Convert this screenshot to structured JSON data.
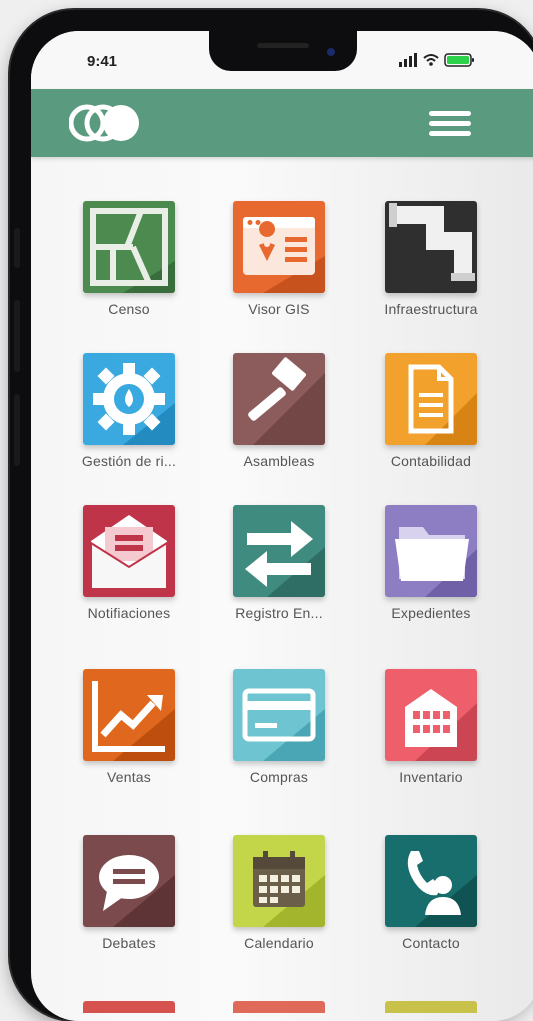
{
  "status_bar": {
    "time": "9:41"
  },
  "app_bar": {
    "logo": "app-logo",
    "menu_icon": "hamburger-menu-icon",
    "color": "#5a9a7f"
  },
  "tiles": [
    {
      "label": "Censo",
      "icon": "census-map-icon",
      "color": "#4d8a4f"
    },
    {
      "label": "Visor GIS",
      "icon": "gis-viewer-icon",
      "color": "#e8692f"
    },
    {
      "label": "Infraestructura",
      "icon": "pipes-icon",
      "color": "#2f2f2f"
    },
    {
      "label": "Gestión de ri...",
      "icon": "water-gear-icon",
      "color": "#3aa9df"
    },
    {
      "label": "Asambleas",
      "icon": "gavel-icon",
      "color": "#8c5b5b"
    },
    {
      "label": "Contabilidad",
      "icon": "document-icon",
      "color": "#f2a12c"
    },
    {
      "label": "Notifiaciones",
      "icon": "envelope-icon",
      "color": "#c0344a"
    },
    {
      "label": "Registro En...",
      "icon": "exchange-arrows-icon",
      "color": "#3f8b80"
    },
    {
      "label": "Expedientes",
      "icon": "folder-icon",
      "color": "#8d7ec4"
    },
    {
      "label": "Ventas",
      "icon": "sales-chart-icon",
      "color": "#e0681e"
    },
    {
      "label": "Compras",
      "icon": "credit-card-icon",
      "color": "#6fc4d1"
    },
    {
      "label": "Inventario",
      "icon": "warehouse-icon",
      "color": "#ee5f6b"
    },
    {
      "label": "Debates",
      "icon": "chat-bubble-icon",
      "color": "#7a4a4c"
    },
    {
      "label": "Calendario",
      "icon": "calendar-icon",
      "color": "#c3d64a"
    },
    {
      "label": "Contacto",
      "icon": "phone-contact-icon",
      "color": "#176e6c"
    }
  ]
}
